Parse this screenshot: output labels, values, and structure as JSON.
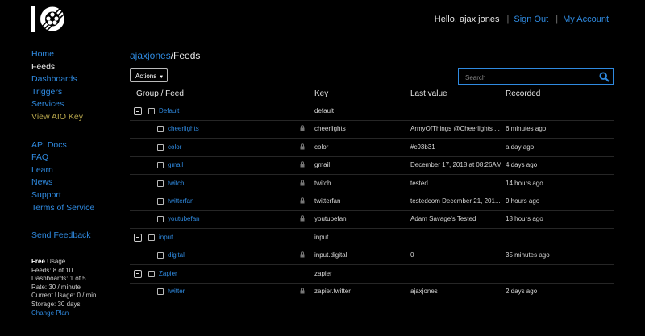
{
  "header": {
    "greeting": "Hello, ajax jones",
    "sign_out": "Sign Out",
    "my_account": "My Account",
    "separator": "|"
  },
  "sidebar": {
    "main_links": [
      {
        "label": "Home",
        "active": false
      },
      {
        "label": "Feeds",
        "active": true
      },
      {
        "label": "Dashboards",
        "active": false
      },
      {
        "label": "Triggers",
        "active": false
      },
      {
        "label": "Services",
        "active": false
      },
      {
        "label": "View AIO Key",
        "active": false
      }
    ],
    "help_links": [
      "API Docs",
      "FAQ",
      "Learn",
      "News",
      "Support",
      "Terms of Service"
    ],
    "feedback": "Send Feedback",
    "usage": {
      "plan": "Free",
      "plan_suffix": " Usage",
      "feeds": "Feeds: 8 of 10",
      "dashboards": "Dashboards: 1 of 5",
      "rate": "Rate: 30 / minute",
      "current": "Current Usage: 0 / min",
      "storage": "Storage: 30 days",
      "change_plan": "Change Plan"
    }
  },
  "breadcrumb": {
    "user": "ajaxjones",
    "sep": "/",
    "page": "Feeds"
  },
  "toolbar": {
    "actions_label": "Actions",
    "search_placeholder": "Search"
  },
  "table": {
    "headers": {
      "group": "Group / Feed",
      "key": "Key",
      "last": "Last value",
      "recorded": "Recorded"
    },
    "rows": [
      {
        "type": "group",
        "name": "Default",
        "key": "default",
        "last": "",
        "recorded": ""
      },
      {
        "type": "feed",
        "name": "cheerlights",
        "key": "cheerlights",
        "last": "ArmyOfThings @Cheerlights ...",
        "recorded": "6 minutes ago"
      },
      {
        "type": "feed",
        "name": "color",
        "key": "color",
        "last": "#c93b31",
        "recorded": "a day ago"
      },
      {
        "type": "feed",
        "name": "gmail",
        "key": "gmail",
        "last": "December 17, 2018 at 08:26AM",
        "recorded": "4 days ago"
      },
      {
        "type": "feed",
        "name": "twitch",
        "key": "twitch",
        "last": "tested",
        "recorded": "14 hours ago"
      },
      {
        "type": "feed",
        "name": "twitterfan",
        "key": "twitterfan",
        "last": "testedcom December 21, 201...",
        "recorded": "9 hours ago"
      },
      {
        "type": "feed",
        "name": "youtubefan",
        "key": "youtubefan",
        "last": "Adam Savage's Tested",
        "recorded": "18 hours ago"
      },
      {
        "type": "group",
        "name": "input",
        "key": "input",
        "last": "",
        "recorded": ""
      },
      {
        "type": "feed",
        "name": "digital",
        "key": "input.digital",
        "last": "0",
        "recorded": "35 minutes ago"
      },
      {
        "type": "group",
        "name": "Zapier",
        "key": "zapier",
        "last": "",
        "recorded": ""
      },
      {
        "type": "feed",
        "name": "twitter",
        "key": "zapier.twitter",
        "last": "ajaxjones",
        "recorded": "2 days ago"
      }
    ]
  },
  "colors": {
    "accent": "#2f8ae0",
    "aio_key": "#b3a24a",
    "background": "#000000"
  }
}
